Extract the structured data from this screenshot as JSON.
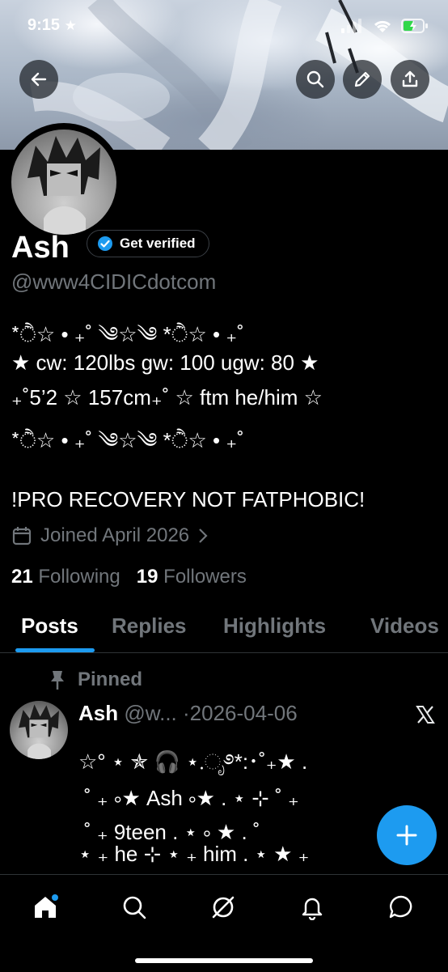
{
  "status_bar": {
    "time": "9:15"
  },
  "profile": {
    "name": "Ash",
    "verify_label": "Get verified",
    "handle": "@www4CIDICdotcom",
    "bio_lines": [
      "*ੈ☆ • ₊˚ ༄☆༄ *ੈ☆ • ₊˚",
      "★ cw: 120lbs gw: 100 ugw: 80 ★",
      "₊˚5’2 ☆ 157cm₊˚ ☆ ftm he/him ☆",
      "*ੈ☆ • ₊˚ ༄☆༄ *ੈ☆ • ₊˚",
      "!PRO RECOVERY NOT FATPHOBIC!"
    ],
    "joined": "Joined April 2026",
    "following_count": "21",
    "following_label": "Following",
    "followers_count": "19",
    "followers_label": "Followers"
  },
  "tabs": [
    {
      "label": "Posts",
      "active": true
    },
    {
      "label": "Replies",
      "active": false
    },
    {
      "label": "Highlights",
      "active": false
    },
    {
      "label": "Videos",
      "active": false
    }
  ],
  "pinned_post": {
    "pinned_label": "Pinned",
    "author": "Ash",
    "handle": "@w...",
    "date": "2026-04-06",
    "lines": [
      "☆° ⋆ ✯ 🎧 ⋆.ೃ࿔*:･˚₊★ .",
      "˚ ₊  ༚★ Ash  ༚★ . ⋆ ⊹ ˚ ₊",
      "˚ ₊  9teen  . ⋆  ༚  ★ . ˚",
      "⋆ ₊  he ⊹ ⋆ ₊  him  . ⋆  ★ ₊"
    ]
  },
  "colors": {
    "accent": "#1d9bf0",
    "muted": "#71767b",
    "background": "#000000"
  },
  "icons": {
    "header": [
      "back-arrow-icon",
      "search-icon",
      "edit-pencil-icon",
      "share-icon"
    ],
    "nav": [
      "home-icon",
      "search-icon",
      "grok-icon",
      "notifications-bell-icon",
      "messages-icon"
    ]
  }
}
